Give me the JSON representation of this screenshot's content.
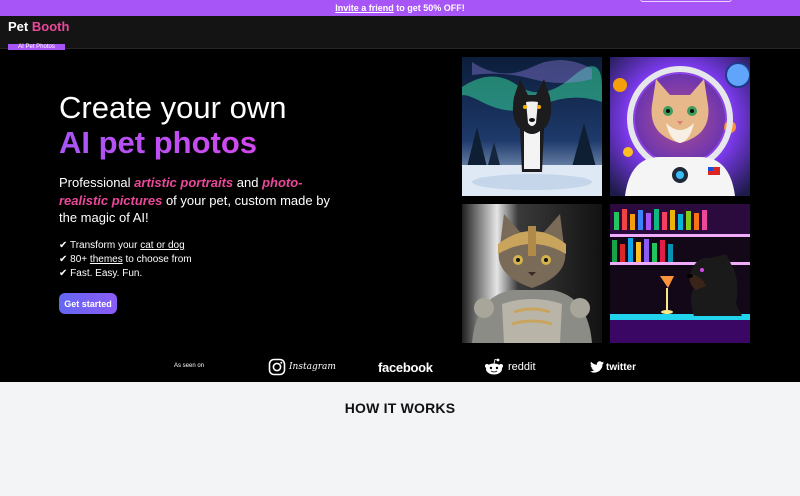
{
  "promo": {
    "link_text": "Invite a friend",
    "rest_text": " to get 50% OFF!"
  },
  "header": {
    "logo_word1": "Pet",
    "logo_word2": "Booth",
    "logo_badge": "AI Pet Photos"
  },
  "hero": {
    "headline_line1": "Create your own",
    "headline_line2": "AI pet photos",
    "lead_1": "Professional ",
    "lead_em1": "artistic portraits",
    "lead_2": " and ",
    "lead_em2": "photo-realistic pictures",
    "lead_3": " of your pet, custom made by the magic of AI!",
    "bullets": [
      {
        "check": "✔",
        "pre": " Transform your ",
        "link": "cat or dog",
        "post": ""
      },
      {
        "check": "✔",
        "pre": " 80+ ",
        "link": "themes",
        "post": " to choose from"
      },
      {
        "check": "✔",
        "pre": " Fast. Easy. Fun.",
        "link": "",
        "post": ""
      }
    ],
    "cta_label": "Get started"
  },
  "gallery": [
    {
      "name": "husky-aurora-photo"
    },
    {
      "name": "astronaut-cat-photo"
    },
    {
      "name": "knight-cat-photo"
    },
    {
      "name": "dog-bar-photo"
    }
  ],
  "seen_on": {
    "label": "As seen on",
    "brands": [
      {
        "name": "Instagram",
        "icon": "instagram-icon"
      },
      {
        "name": "facebook",
        "icon": ""
      },
      {
        "name": "reddit",
        "icon": "reddit-icon"
      },
      {
        "name": "twitter",
        "icon": "twitter-bird-icon"
      }
    ]
  },
  "how_it_works": {
    "title": "HOW IT WORKS"
  },
  "colors": {
    "accent_purple": "#a855f7",
    "accent_pink": "#ec4899",
    "cta_start": "#6366f1",
    "cta_end": "#8b5cf6"
  }
}
